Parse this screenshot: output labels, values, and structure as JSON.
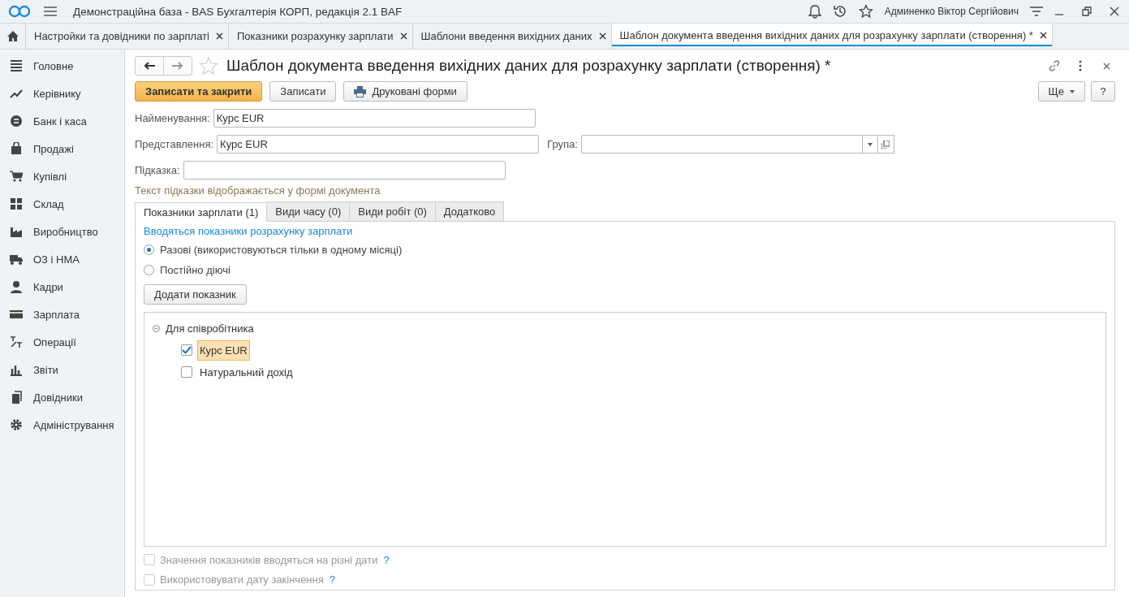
{
  "app": {
    "title": "Демонстраційна база - BAS Бухгалтерія КОРП, редакція 2.1 BAF",
    "user": "Админенко Віктор Сергійович"
  },
  "tabs": [
    {
      "label": "Настройки та довідники по зарплаті",
      "selected": false
    },
    {
      "label": "Показники розрахунку зарплати",
      "selected": false
    },
    {
      "label": "Шаблони введення вихідних даних",
      "selected": false
    },
    {
      "label": "Шаблон документа введення вихідних даних для розрахунку зарплати (створення) *",
      "selected": true
    }
  ],
  "sidebar": {
    "items": [
      {
        "label": "Головне"
      },
      {
        "label": "Керівнику"
      },
      {
        "label": "Банк і каса"
      },
      {
        "label": "Продажі"
      },
      {
        "label": "Купівлі"
      },
      {
        "label": "Склад"
      },
      {
        "label": "Виробництво"
      },
      {
        "label": "ОЗ і НМА"
      },
      {
        "label": "Кадри"
      },
      {
        "label": "Зарплата"
      },
      {
        "label": "Операції"
      },
      {
        "label": "Звіти"
      },
      {
        "label": "Довідники"
      },
      {
        "label": "Адміністрування"
      }
    ]
  },
  "form": {
    "title": "Шаблон документа введення вихідних даних для розрахунку зарплати (створення) *",
    "buttons": [
      {
        "label": "Записати та закрити",
        "kind": "primary"
      },
      {
        "label": "Записати",
        "kind": "plain"
      },
      {
        "label": "Друковані форми",
        "kind": "print"
      }
    ],
    "more_button": "Ще",
    "help_button": "?",
    "name_field": {
      "label": "Найменування:",
      "value": "Курс EUR"
    },
    "presentation_field": {
      "label": "Представлення:",
      "value": "Курс EUR"
    },
    "group_field": {
      "label": "Група:"
    },
    "hint_field": {
      "label": "Підказка:"
    },
    "hint_note": "Текст підказки відображається у формі документа",
    "inner_tabs": [
      {
        "label": "Показники зарплати (1)",
        "selected": true
      },
      {
        "label": "Види часу (0)",
        "selected": false
      },
      {
        "label": "Види робіт (0)",
        "selected": false
      },
      {
        "label": "Додатково",
        "selected": false
      }
    ],
    "section_title": "Вводяться показники розрахунку зарплати",
    "radios": [
      {
        "label": "Разові (використовуються тільки в одному місяці)",
        "selected": true
      },
      {
        "label": "Постійно діючі",
        "selected": false
      }
    ],
    "add_button": "Додати показник",
    "tree": {
      "label": "Для співробітника",
      "expanded": true,
      "children": [
        {
          "label": "Курс EUR",
          "checked": true,
          "selected": true
        },
        {
          "label": "Натуральний дохід",
          "checked": false,
          "selected": false
        }
      ]
    },
    "options": [
      {
        "label": "Значення показників вводяться на різні дати",
        "checked": false,
        "disabled": true,
        "help": "?"
      },
      {
        "label": "Використовувати дату закінчення",
        "checked": false,
        "disabled": true,
        "help": "?"
      }
    ]
  }
}
